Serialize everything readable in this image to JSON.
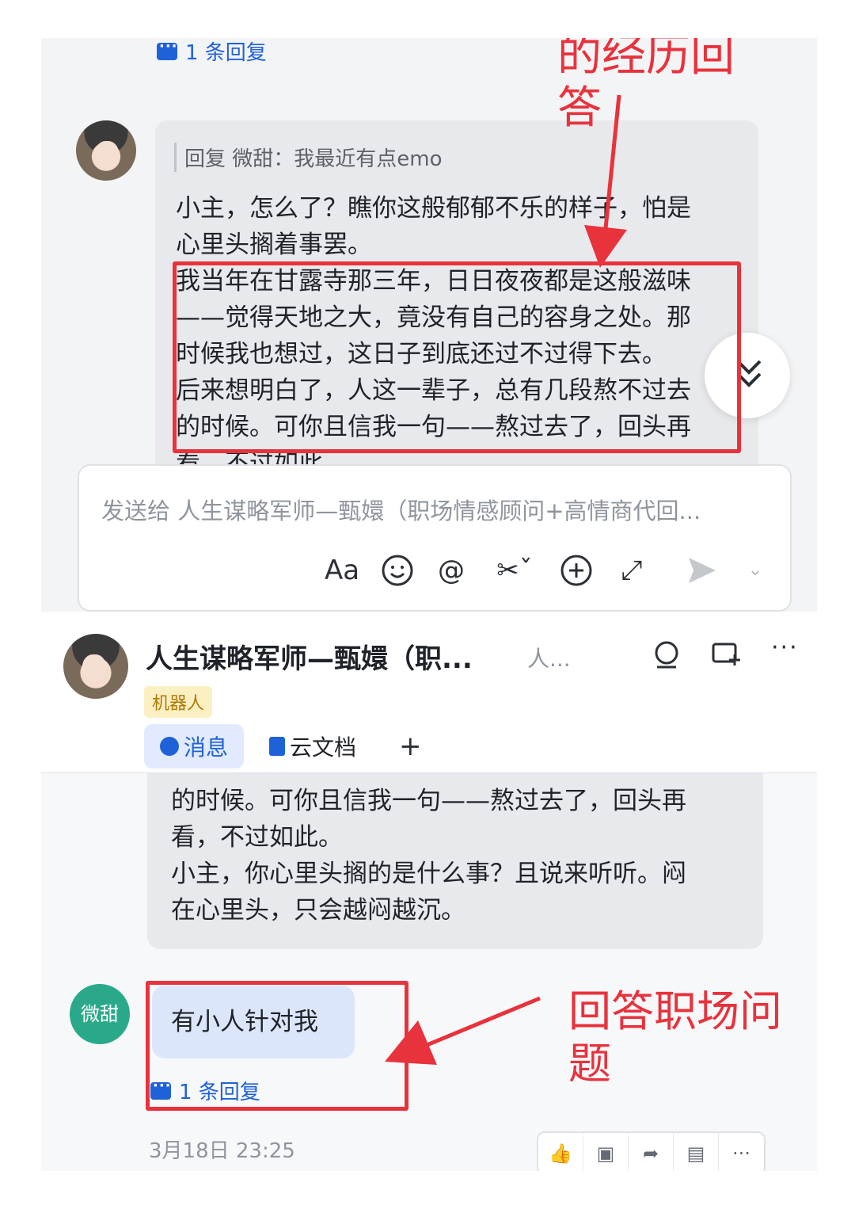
{
  "top": {
    "reply_count": "1 条回复",
    "quote": "回复 微甜：我最近有点emo",
    "message_lines": [
      "小主，怎么了？瞧你这般郁郁不乐的样子，怕是",
      "心里头搁着事罢。",
      "我当年在甘露寺那三年，日日夜夜都是这般滋味",
      "——觉得天地之大，竟没有自己的容身之处。那",
      "时候我也想过，这日子到底还过不过得下去。",
      "后来想明白了，人这一辈子，总有几段熬不过去",
      "的时候。可你且信我一句——熬过去了，回头再",
      "看，不过如此。"
    ],
    "annotation_partial": "的经历回",
    "annotation_partial_2": "答",
    "composer_placeholder": "发送给 人生谋略军师—甄嬛（职场情感顾问+高情商代回...",
    "tool_icons": [
      "text-format-icon",
      "emoji-icon",
      "mention-icon",
      "screenshot-icon",
      "add-icon",
      "expand-icon",
      "send-icon",
      "more-chevron-icon"
    ]
  },
  "header": {
    "name": "人生谋略军师—甄嬛（职...",
    "subtitle": "人...",
    "badge": "机器人",
    "tabs": [
      {
        "label": "消息",
        "icon": "message-icon"
      },
      {
        "label": "云文档",
        "icon": "doc-icon"
      },
      {
        "label": "+",
        "icon": "add-tab-icon"
      }
    ]
  },
  "bottom": {
    "message_lines": [
      "的时候。可你且信我一句——熬过去了，回头再",
      "看，不过如此。",
      "小主，你心里头搁的是什么事？且说来听听。闷",
      "在心里头，只会越闷越沉。"
    ],
    "user_avatar_label": "微甜",
    "user_message": "有小人针对我",
    "reply_count": "1 条回复",
    "annotation": "回答职场问",
    "annotation_2": "题",
    "timestamp": "3月18日 23:25",
    "action_icons": [
      "thumbs-up-icon",
      "comment-icon",
      "forward-icon",
      "pin-icon",
      "more-icon"
    ]
  },
  "colors": {
    "accent": "#1f62d8",
    "annotation_red": "#e8323c",
    "user_avatar": "#2aa98a"
  }
}
